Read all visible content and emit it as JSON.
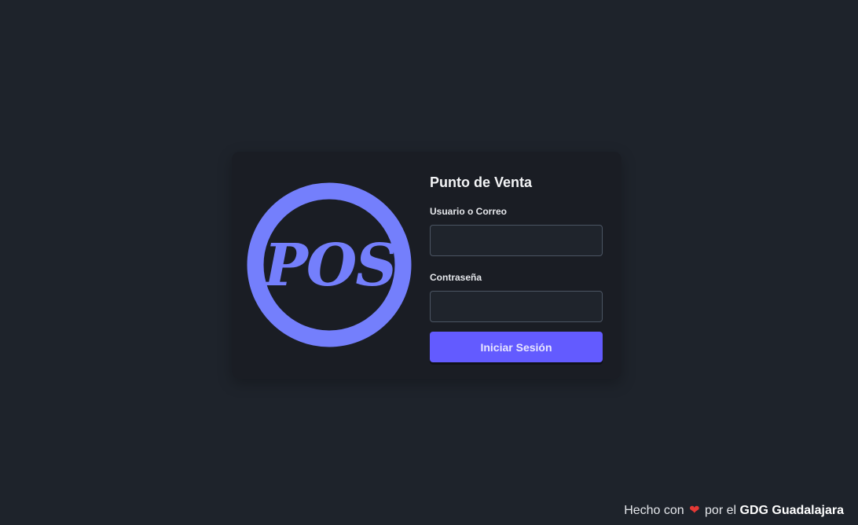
{
  "login": {
    "logo_text": "POS",
    "title": "Punto de Venta",
    "user_label": "Usuario o Correo",
    "user_value": "",
    "user_placeholder": "",
    "password_label": "Contraseña",
    "password_value": "",
    "password_placeholder": "",
    "submit_label": "Iniciar Sesión"
  },
  "footer": {
    "prefix": "Hecho con",
    "heart_icon": "❤",
    "middle": "por el",
    "org": "GDG Guadalajara"
  },
  "colors": {
    "background": "#1e232b",
    "card": "#1a1d24",
    "logo": "#747ffc",
    "accent": "#635bff",
    "heart": "#e53935"
  }
}
